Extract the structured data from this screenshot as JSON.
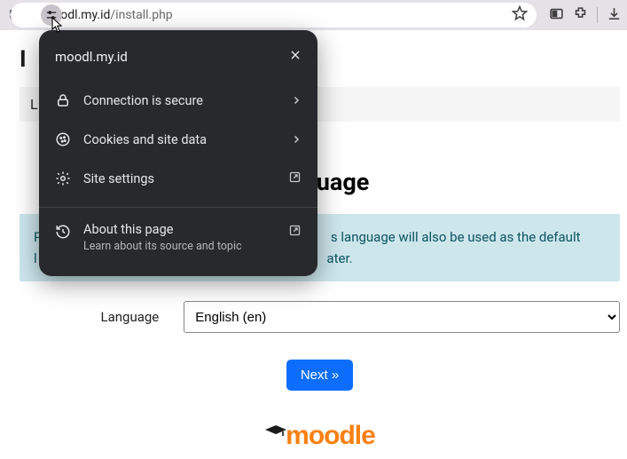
{
  "address": {
    "host": "moodl.my.id",
    "path": "/install.php"
  },
  "page": {
    "title_left": "I",
    "lang_bar_left": "L",
    "choose_title_partial": "language",
    "info_partial_a": "P",
    "info_partial_b": "s language will also be used as the default",
    "info_partial_c": "l",
    "info_partial_d": "ater.",
    "form_label": "Language",
    "select_value": "English (en)",
    "next_label": "Next  »",
    "logo_text": "moodle"
  },
  "popup": {
    "host": "moodl.my.id",
    "secure": "Connection is secure",
    "cookies": "Cookies and site data",
    "settings": "Site settings",
    "about_title": "About this page",
    "about_sub": "Learn about its source and topic"
  }
}
